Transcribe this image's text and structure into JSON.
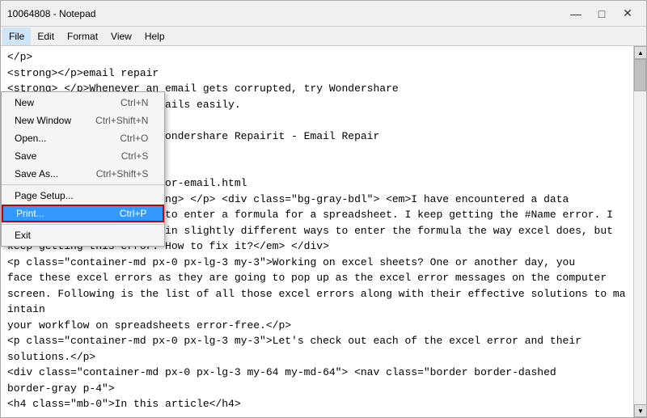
{
  "window": {
    "title": "10064808 - Notepad",
    "controls": {
      "minimize": "—",
      "maximize": "□",
      "close": "✕"
    }
  },
  "menubar": {
    "items": [
      "File",
      "Edit",
      "Format",
      "View",
      "Help"
    ],
    "active": "File"
  },
  "dropdown": {
    "items": [
      {
        "label": "New",
        "shortcut": "Ctrl+N",
        "separator": false,
        "highlighted": false
      },
      {
        "label": "New Window",
        "shortcut": "Ctrl+Shift+N",
        "separator": false,
        "highlighted": false
      },
      {
        "label": "Open...",
        "shortcut": "Ctrl+O",
        "separator": false,
        "highlighted": false
      },
      {
        "label": "Save",
        "shortcut": "Ctrl+S",
        "separator": false,
        "highlighted": false
      },
      {
        "label": "Save As...",
        "shortcut": "Ctrl+Shift+S",
        "separator": true,
        "highlighted": false
      },
      {
        "label": "Page Setup...",
        "shortcut": "",
        "separator": false,
        "highlighted": false
      },
      {
        "label": "Print...",
        "shortcut": "Ctrl+P",
        "separator": true,
        "highlighted": true
      },
      {
        "label": "Exit",
        "shortcut": "",
        "separator": false,
        "highlighted": false
      }
    ]
  },
  "content": {
    "text": "</p>\n<strong></p>email repair\n<strong> </p>Whenever an email gets corrupted, try Wondershare\ns you repair corrupted emails easily.\n> </p> 10064808\nong> </p>A Guide to Use Wondershare Repairit - Email Repair\n<strong> </p>Excel repair\n> </p> 10005682\nng> </p>/guide/repairit-for-email.html\n<p><strong>content:</strong> </p> <div class=\"bg-gray-bdl\"> <em>I have encountered a data\nentry problem when I try to enter a formula for a spreadsheet. I keep getting the #Name error. I\ntried numerous times and in slightly different ways to enter the formula the way excel does, but\nkeep getting this error. How to fix it?</em> </div>\n<p class=\"container-md px-0 px-lg-3 my-3\">Working on excel sheets? One or another day, you\nface these excel errors as they are going to pop up as the excel error messages on the computer\nscreen. Following is the list of all those excel errors along with their effective solutions to maintain\nyour workflow on spreadsheets error-free.</p>\n<p class=\"container-md px-0 px-lg-3 my-3\">Let's check out each of the excel error and their\nsolutions.</p>\n<div class=\"container-md px-0 px-lg-3 my-64 my-md-64\"> <nav class=\"border border-dashed\nborder-gray p-4\">\n<h4 class=\"mb-0\">In this article</h4>"
  }
}
